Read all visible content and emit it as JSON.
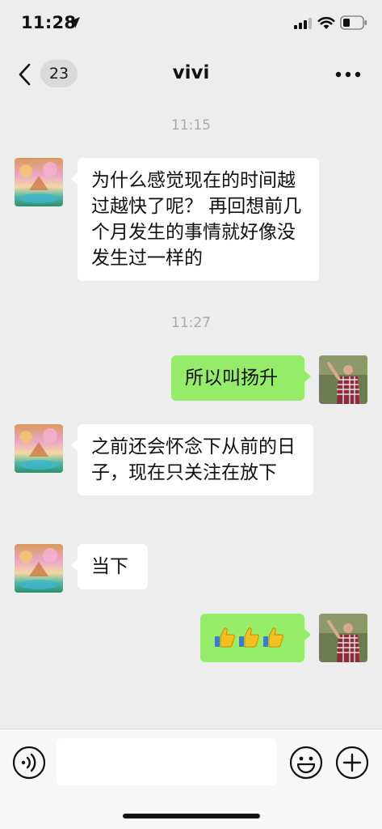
{
  "status_bar": {
    "time": "11:28"
  },
  "nav": {
    "back_count": "23",
    "title": "vivi"
  },
  "messages": [
    {
      "type": "time",
      "text": "11:15"
    },
    {
      "type": "in",
      "text": "为什么感觉现在的时间越过越快了呢？ 再回想前几个月发生的事情就好像没发生过一样的"
    },
    {
      "type": "time",
      "text": "11:27"
    },
    {
      "type": "out",
      "text": "所以叫扬升"
    },
    {
      "type": "in",
      "text": "之前还会怀念下从前的日子，现在只关注在放下"
    },
    {
      "type": "in",
      "text": "当下"
    },
    {
      "type": "out",
      "text": "",
      "emoji": [
        "thumbs-up",
        "thumbs-up",
        "thumbs-up"
      ]
    }
  ],
  "input": {
    "placeholder": ""
  },
  "colors": {
    "background": "#ededed",
    "incoming_bubble": "#ffffff",
    "outgoing_bubble": "#95ec69",
    "timestamp": "#a9a9a9"
  }
}
